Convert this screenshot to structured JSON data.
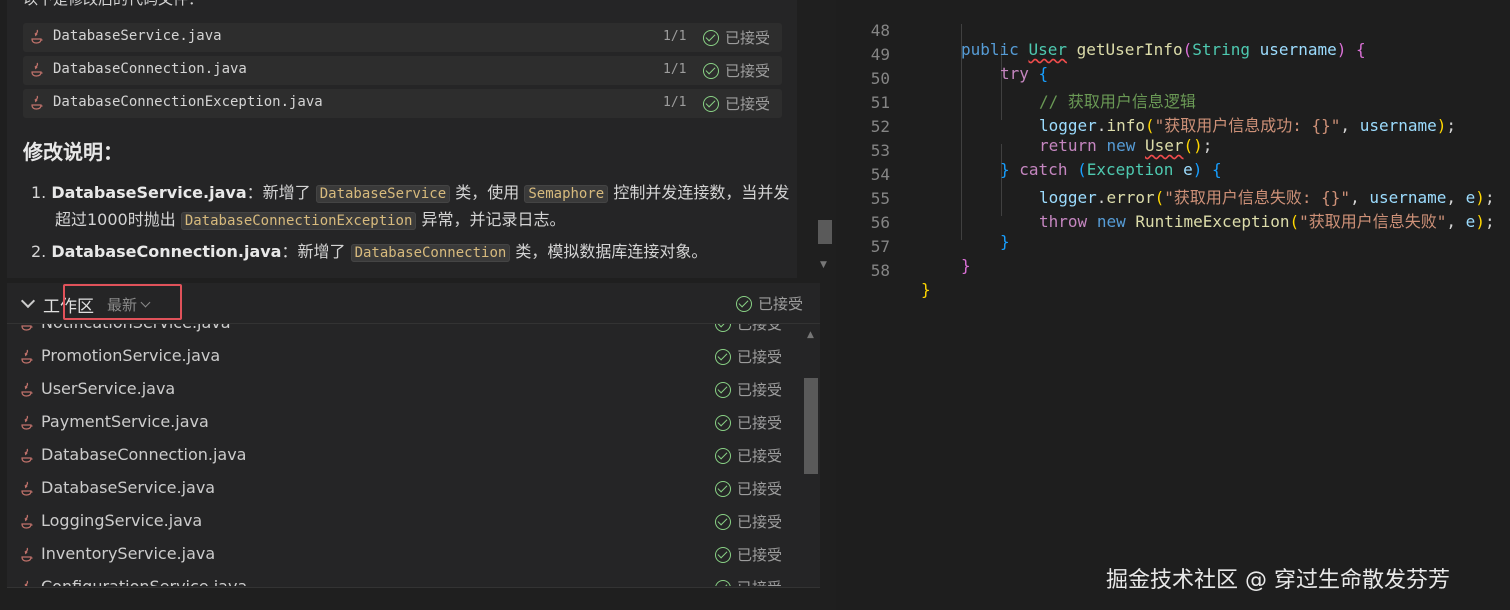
{
  "chat": {
    "intro": "以下是修改后的代码文件：",
    "files": [
      {
        "name": "DatabaseService.java",
        "count": "1/1",
        "status": "已接受"
      },
      {
        "name": "DatabaseConnection.java",
        "count": "1/1",
        "status": "已接受"
      },
      {
        "name": "DatabaseConnectionException.java",
        "count": "1/1",
        "status": "已接受"
      }
    ],
    "heading": "修改说明：",
    "items": [
      {
        "num": "1.",
        "file": "DatabaseService.java",
        "sep": "：新增了",
        "chip1": "DatabaseService",
        "mid": "类，使用",
        "chip2": "Semaphore",
        "tail": "控制并发连接数，当并发",
        "cont_pre": "超过1000时抛出",
        "cont_chip": "DatabaseConnectionException",
        "cont_tail": "异常，并记录日志。"
      },
      {
        "num": "2.",
        "file": "DatabaseConnection.java",
        "sep": "：新增了",
        "chip1": "DatabaseConnection",
        "tail": "类，模拟数据库连接对象。"
      }
    ]
  },
  "workspace": {
    "title": "工作区",
    "filter": "最新",
    "header_status": "已接受",
    "files": [
      {
        "name": "NotificationService.java",
        "status": "已接受"
      },
      {
        "name": "PromotionService.java",
        "status": "已接受"
      },
      {
        "name": "UserService.java",
        "status": "已接受"
      },
      {
        "name": "PaymentService.java",
        "status": "已接受"
      },
      {
        "name": "DatabaseConnection.java",
        "status": "已接受"
      },
      {
        "name": "DatabaseService.java",
        "status": "已接受"
      },
      {
        "name": "LoggingService.java",
        "status": "已接受"
      },
      {
        "name": "InventoryService.java",
        "status": "已接受"
      },
      {
        "name": "ConfigurationService.java",
        "status": "已接受"
      }
    ]
  },
  "editor": {
    "line_numbers": [
      "48",
      "49",
      "50",
      "51",
      "52",
      "53",
      "54",
      "55",
      "56",
      "57",
      "58"
    ],
    "code": {
      "l48": {
        "kw": "public",
        "type": "User",
        "fn": "getUserInfo",
        "paren_open": "(",
        "ptype": "String",
        "param": "username",
        "paren_close": ")",
        "brace": "{"
      },
      "l49": {
        "kw": "try",
        "brace": "{"
      },
      "l50": {
        "comment": "// 获取用户信息逻辑"
      },
      "l51": {
        "obj": "logger",
        "method": "info",
        "str": "\"获取用户信息成功: {}\"",
        "arg": "username"
      },
      "l52": {
        "kw": "return",
        "kw2": "new",
        "type": "User"
      },
      "l53": {
        "brace_close": "}",
        "kw": "catch",
        "type": "Exception",
        "var": "e",
        "brace": "{"
      },
      "l54": {
        "obj": "logger",
        "method": "error",
        "str": "\"获取用户信息失败: {}\"",
        "arg": "username",
        "arg2": "e"
      },
      "l55": {
        "kw": "throw",
        "kw2": "new",
        "type": "RuntimeException",
        "str": "\"获取用户信息失败\"",
        "arg": "e"
      },
      "l56": {
        "brace": "}"
      },
      "l57": {
        "brace": "}"
      },
      "l58": {
        "brace": "}"
      }
    }
  },
  "watermark": "掘金技术社区 @ 穿过生命散发芬芳"
}
